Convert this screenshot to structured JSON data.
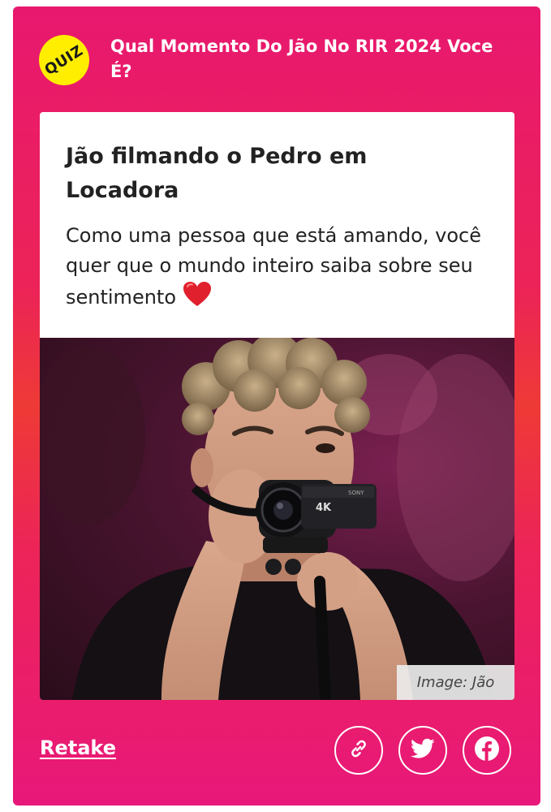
{
  "quiz": {
    "badge_label": "QUIZ",
    "title": "Qual Momento Do Jão No RIR 2024 Voce É?"
  },
  "result": {
    "title": "Jão filmando o Pedro em Locadora",
    "description": "Como uma pessoa que está amando, você quer que o mundo inteiro saiba sobre seu sentimento",
    "emoji": "heart-icon",
    "image_credit": "Image: Jão",
    "camera_brand": "SONY",
    "camera_badge": "4K"
  },
  "actions": {
    "retake_label": "Retake",
    "share": [
      {
        "icon": "link-icon"
      },
      {
        "icon": "twitter-icon"
      },
      {
        "icon": "facebook-icon"
      }
    ]
  },
  "colors": {
    "card_top": "#e8186f",
    "card_middle": "#ee3a36",
    "badge": "#ffee00",
    "text": "#222222"
  }
}
